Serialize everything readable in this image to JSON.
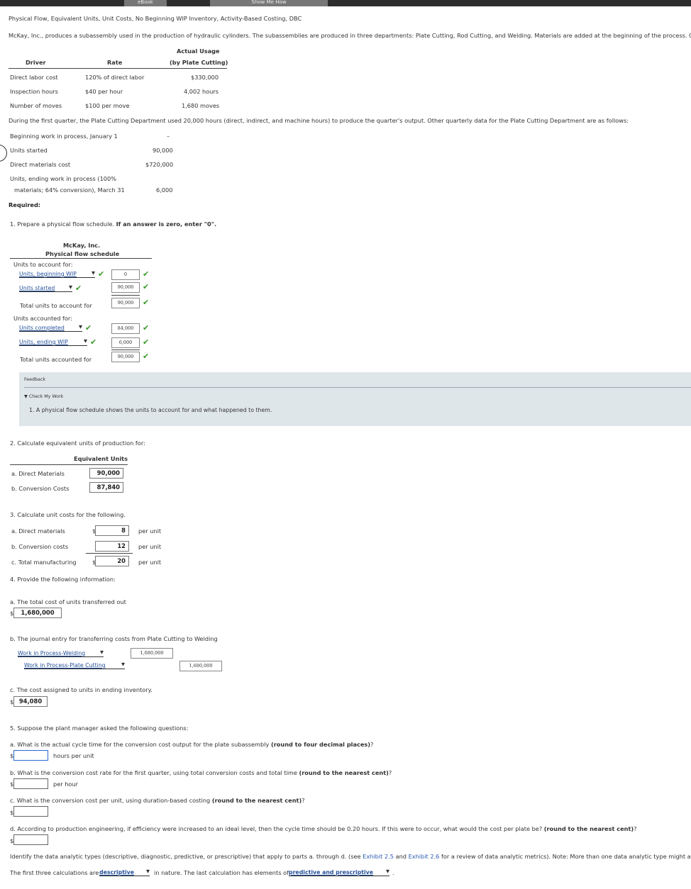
{
  "header": {
    "tab_ebook": "eBook",
    "tab_show_me": "Show Me How",
    "title": "Physical Flow, Equivalent Units, Unit Costs, No Beginning WIP Inventory, Activity-Based Costing, DBC",
    "intro": "McKay, Inc., produces a subassembly used in the production of hydraulic cylinders. The subassemblies are produced in three departments: Plate Cutting, Rod Cutting, and Welding. Materials are added at the beginning of the process. Overh"
  },
  "overhead_table": {
    "col_driver": "Driver",
    "col_rate": "Rate",
    "col_usage_1": "Actual Usage",
    "col_usage_2": "(by Plate Cutting)",
    "rows": [
      {
        "driver": "Direct labor cost",
        "rate": "120% of direct labor",
        "usage": "$330,000"
      },
      {
        "driver": "Inspection hours",
        "rate": "$40 per hour",
        "usage": "4,002 hours"
      },
      {
        "driver": "Number of moves",
        "rate": "$100 per move",
        "usage": "1,680 moves"
      }
    ]
  },
  "quarter_text": "During the first quarter, the Plate Cutting Department used 20,000 hours (direct, indirect, and machine hours) to produce the quarter's output. Other quarterly data for the Plate Cutting Department are as follows:",
  "quarter_data": {
    "beg_label": "Beginning work in process, January 1",
    "beg_value": "–",
    "started_label": "Units started",
    "started_value": "90,000",
    "dm_label": "Direct materials cost",
    "dm_value": "$720,000",
    "ending_label_1": "Units, ending work in process (100%",
    "ending_label_2": "materials; 64% conversion), March 31",
    "ending_value": "6,000"
  },
  "required_label": "Required:",
  "q1": {
    "prompt": "1. Prepare a physical flow schedule.",
    "prompt_bold": "If an answer is zero, enter \"0\".",
    "company": "McKay, Inc.",
    "schedule_title": "Physical flow schedule",
    "account_for_label": "Units to account for:",
    "dd_beg": "Units, beginning WIP",
    "val_beg": "0",
    "dd_started": "Units started",
    "val_started": "90,000",
    "total_account_label": "Total units to account for",
    "val_total_account": "90,000",
    "accounted_label": "Units accounted for:",
    "dd_completed": "Units completed",
    "val_completed": "84,000",
    "dd_ending": "Units, ending WIP",
    "val_ending": "6,000",
    "total_accounted_label": "Total units accounted for",
    "val_total_accounted": "90,000",
    "check": "✔"
  },
  "feedback": {
    "title": "Feedback",
    "toggle": "▼ Check My Work",
    "text": "1. A physical flow schedule shows the units to account for and what happened to them."
  },
  "q2": {
    "prompt": "2. Calculate equivalent units of production for:",
    "header": "Equivalent Units",
    "dm_label": "a. Direct Materials",
    "dm_value": "90,000",
    "cc_label": "b. Conversion Costs",
    "cc_value": "87,840"
  },
  "q3": {
    "prompt": "3. Calculate unit costs for the following.",
    "dm_label": "a. Direct materials",
    "dm_value": "8",
    "cc_label": "b. Conversion costs",
    "cc_value": "12",
    "tm_label": "c. Total manufacturing",
    "tm_value": "20",
    "currency": "$",
    "per_unit": "per unit"
  },
  "q4": {
    "prompt": "4. Provide the following information:",
    "a_label": "a. The total cost of units transferred out",
    "a_value": "1,680,000",
    "b_label": "b. The journal entry for transferring costs from Plate Cutting to Welding",
    "je_debit_account": "Work in Process-Welding",
    "je_debit_value": "1,680,000",
    "je_credit_account": "Work in Process-Plate Cutting",
    "je_credit_value": "1,680,000",
    "c_label": "c. The cost assigned to units in ending inventory.",
    "c_value": "94,080",
    "currency": "$"
  },
  "q5": {
    "prompt": "5. Suppose the plant manager asked the following questions:",
    "a_label": "a.   What is the actual cycle time for the conversion cost output for the plate subassembly",
    "a_bold": "(round to four decimal places)",
    "a_suffix": "?",
    "a_unit": "hours per unit",
    "b_label": "b.   What is the conversion cost rate for the first quarter, using total conversion costs and total time",
    "b_bold": "(round to the nearest cent)",
    "b_suffix": "?",
    "b_unit": "per hour",
    "c_label": "c.   What is the conversion cost per unit, using duration-based costing",
    "c_bold": "(round to the nearest cent)",
    "c_suffix": "?",
    "d_label": "d.   According to production engineering, if efficiency were increased to an ideal level, then the cycle time should be 0.20 hours. If this were to occur, what would the cost per plate be?",
    "d_bold": "(round to the nearest cent)",
    "d_suffix": "?",
    "currency": "$",
    "analytics_pre": "Identify the data analytic types (descriptive, diagnostic, predictive, or prescriptive) that apply to parts a. through d. (see",
    "exhibit_25": "Exhibit 2.5",
    "and": "and",
    "exhibit_26": "Exhibit 2.6",
    "analytics_post": "for a review of data analytic metrics). Note: More than one data analytic type might apply",
    "sentence_pre": "The first three calculations are",
    "dd_first": "descriptive",
    "sentence_mid": "in nature. The last calculation has elements of",
    "dd_last": "predictive and prescriptive",
    "sentence_end": "."
  }
}
